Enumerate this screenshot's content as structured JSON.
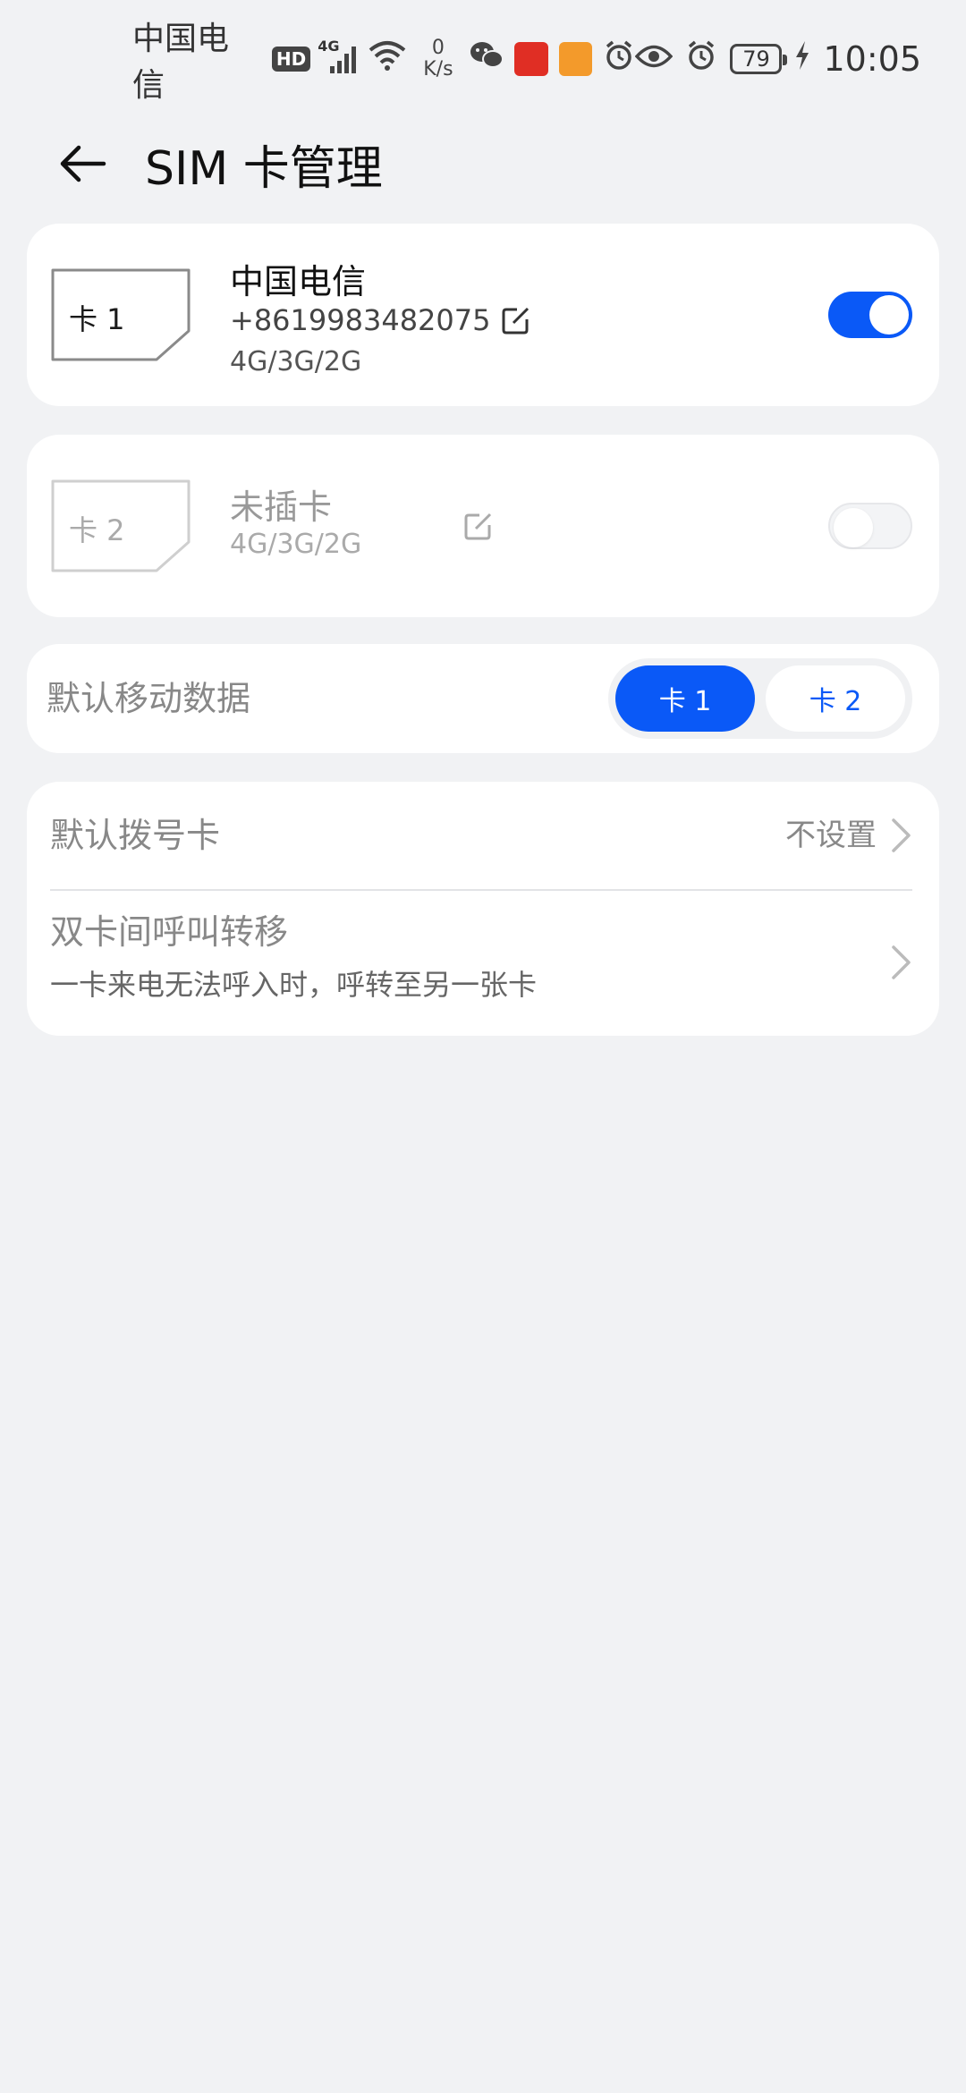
{
  "status_bar": {
    "carrier": "中国电信",
    "hd": "HD",
    "network_type": "4G",
    "net_speed_value": "0",
    "net_speed_unit": "K/s",
    "battery": "79",
    "time": "10:05"
  },
  "header": {
    "title": "SIM 卡管理"
  },
  "sim1": {
    "slot_label": "卡 1",
    "name": "中国电信",
    "number": "+8619983482075",
    "network": "4G/3G/2G",
    "enabled": true
  },
  "sim2": {
    "slot_label": "卡 2",
    "name": "未插卡",
    "network": "4G/3G/2G",
    "enabled": false
  },
  "default_data": {
    "label": "默认移动数据",
    "options": [
      "卡 1",
      "卡 2"
    ],
    "selected": "卡 1"
  },
  "default_dial": {
    "label": "默认拨号卡",
    "value": "不设置"
  },
  "call_forward": {
    "title": "双卡间呼叫转移",
    "subtitle": "一卡来电无法呼入时，呼转至另一张卡"
  },
  "colors": {
    "accent": "#0a59f7",
    "background": "#f1f2f4",
    "card": "#ffffff"
  }
}
